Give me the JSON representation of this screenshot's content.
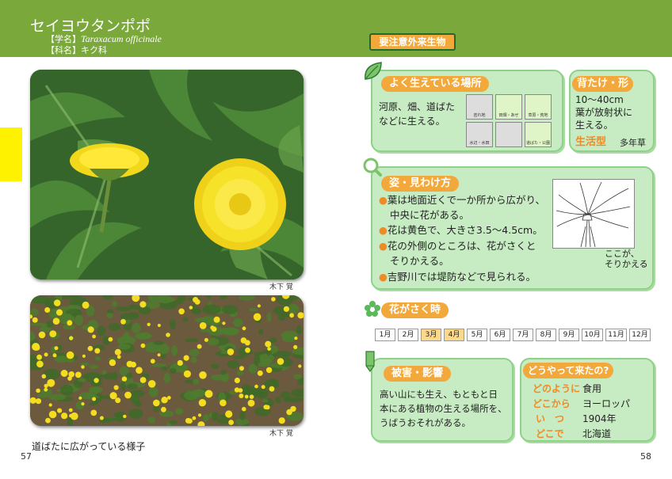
{
  "species": {
    "name": "セイヨウタンポポ",
    "sci_label": "【学名】",
    "sci_name": "Taraxacum officinale",
    "family_label": "【科名】",
    "family_name": "キク科"
  },
  "badge": "要注意外来生物",
  "photos": {
    "credit1": "木下 覚",
    "credit2": "木下 覚",
    "caption": "道ばたに広がっている様子"
  },
  "pages": {
    "left": "57",
    "right": "58"
  },
  "habitat": {
    "title": "よく生えている場所",
    "text_line1": "河原、畑、道ばた",
    "text_line2": "などに生える。",
    "cells": [
      {
        "label": "岩れ地",
        "active": false
      },
      {
        "label": "田畑・あぜ",
        "active": true
      },
      {
        "label": "草原・荒地",
        "active": true
      },
      {
        "label": "水辺・水田",
        "active": false
      },
      {
        "label": "",
        "active": false
      },
      {
        "label": "道ばた・公園",
        "active": true
      }
    ]
  },
  "height": {
    "title": "背たけ・形",
    "line1": "10〜40cm",
    "line2": "葉が放射状に",
    "line3": "生える。",
    "life_label": "生活型",
    "life_value": "多年草"
  },
  "shape": {
    "title": "姿・見わけ方",
    "bullets": [
      [
        "●",
        "葉は地面近くで一か所から広がり、",
        "中央に花がある。"
      ],
      [
        "●",
        "花は黄色で、大きさ3.5〜4.5cm。",
        ""
      ],
      [
        "●",
        "花の外側のところは、花がさくと",
        "そりかえる。"
      ],
      [
        "●",
        "吉野川では堤防などで見られる。",
        ""
      ]
    ],
    "note_line1": "ここが、",
    "note_line2": "そりかえる"
  },
  "flowering": {
    "title": "花がさく時",
    "months": [
      {
        "label": "1月",
        "active": false
      },
      {
        "label": "2月",
        "active": false
      },
      {
        "label": "3月",
        "active": true
      },
      {
        "label": "4月",
        "active": true
      },
      {
        "label": "5月",
        "active": false
      },
      {
        "label": "6月",
        "active": false
      },
      {
        "label": "7月",
        "active": false
      },
      {
        "label": "8月",
        "active": false
      },
      {
        "label": "9月",
        "active": false
      },
      {
        "label": "10月",
        "active": false
      },
      {
        "label": "11月",
        "active": false
      },
      {
        "label": "12月",
        "active": false
      }
    ]
  },
  "damage": {
    "title": "被害・影響",
    "line1": "高い山にも生え、もともと日",
    "line2": "本にある植物の生える場所を、",
    "line3": "うばうおそれがある。"
  },
  "origin": {
    "title": "どうやって来たの?",
    "rows": [
      {
        "key": "どのように",
        "value": "食用"
      },
      {
        "key": "どこから",
        "value": "ヨーロッパ"
      },
      {
        "key": "い　つ",
        "value": "1904年"
      },
      {
        "key": "どこで",
        "value": "北海道"
      }
    ]
  },
  "colors": {
    "header": "#7aa83a",
    "box": "#c7ebc2",
    "accent": "#f3a83b",
    "tab": "#fff200"
  }
}
